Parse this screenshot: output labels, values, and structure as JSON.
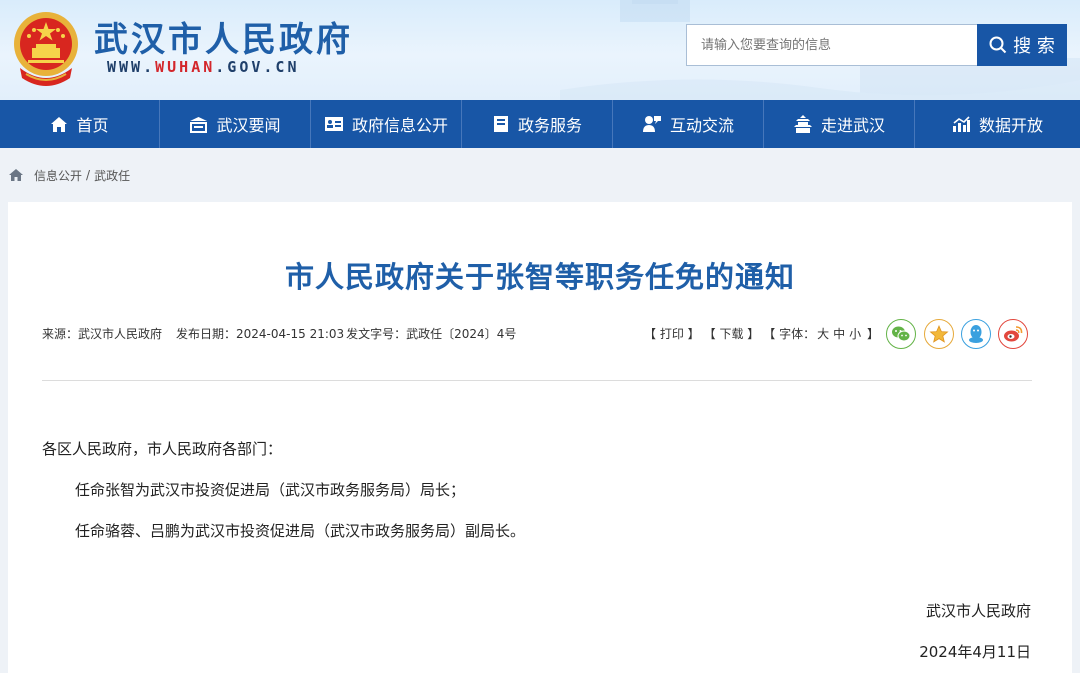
{
  "header": {
    "site_title": "武汉市人民政府",
    "domain_prefix": "WWW.",
    "domain_highlight": "WUHAN",
    "domain_suffix": ".GOV.CN",
    "search_placeholder": "请输入您要查询的信息",
    "search_label": "搜 索"
  },
  "nav": {
    "items": [
      {
        "label": "首页",
        "icon": "home-icon"
      },
      {
        "label": "武汉要闻",
        "icon": "news-icon"
      },
      {
        "label": "政府信息公开",
        "icon": "info-card-icon"
      },
      {
        "label": "政务服务",
        "icon": "service-icon"
      },
      {
        "label": "互动交流",
        "icon": "chat-icon"
      },
      {
        "label": "走进武汉",
        "icon": "tower-icon"
      },
      {
        "label": "数据开放",
        "icon": "chart-icon"
      }
    ]
  },
  "breadcrumb": {
    "items": [
      "信息公开",
      "武政任"
    ],
    "separator": "/"
  },
  "article": {
    "title": "市人民政府关于张智等职务任免的通知",
    "source": "来源：武汉市人民政府",
    "publish_date": "发布日期：2024-04-15 21:03",
    "doc_number": "发文字号：武政任〔2024〕4号",
    "tools": {
      "print": "【 打印 】",
      "download": "【 下载 】",
      "font_label": "【 字体：",
      "font_large": "大",
      "font_medium": "中",
      "font_small": "小",
      "font_close": " 】"
    },
    "greeting": "各区人民政府，市人民政府各部门：",
    "paragraphs": [
      "任命张智为武汉市投资促进局（武汉市政务服务局）局长；",
      "任命骆蓉、吕鹏为武汉市投资促进局（武汉市政务服务局）副局长。"
    ],
    "signature_org": "武汉市人民政府",
    "signature_date": "2024年4月11日"
  },
  "colors": {
    "brand_blue": "#1856a6",
    "title_blue": "#1f5fa8",
    "domain_red": "#d3262b"
  }
}
